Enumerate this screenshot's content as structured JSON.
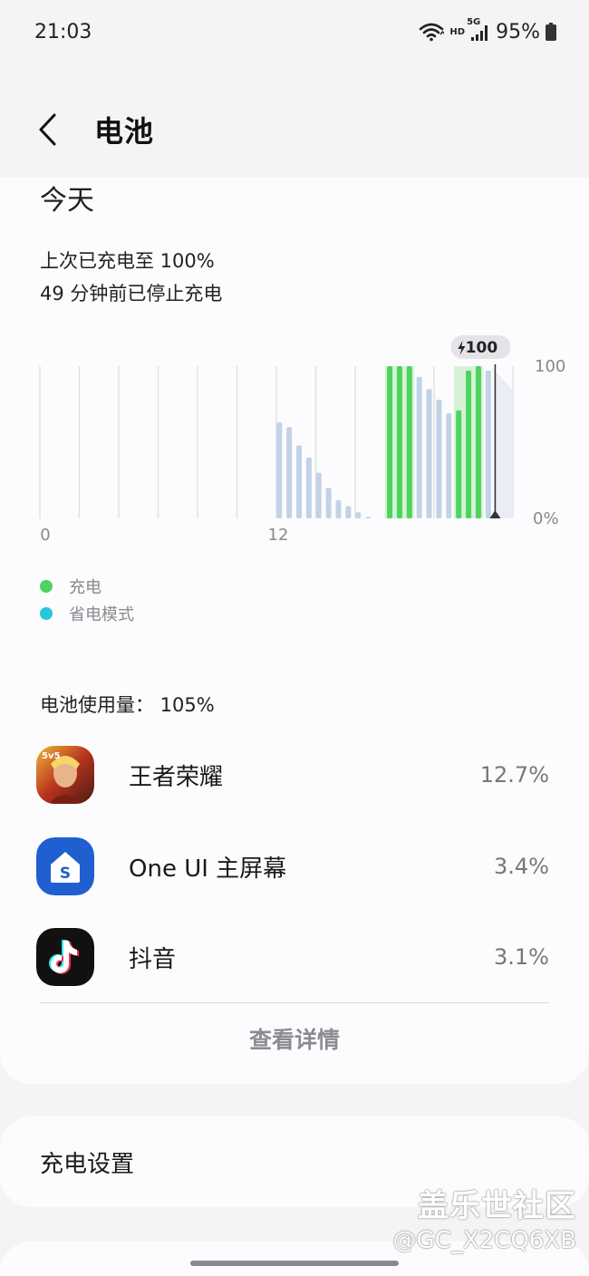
{
  "status_bar": {
    "time": "21:03",
    "hd": "HD",
    "network": "5G",
    "battery": "95%"
  },
  "header": {
    "title": "电池"
  },
  "summary": {
    "day_label": "今天",
    "last_charged": "上次已充电至 100%",
    "stopped": "49 分钟前已停止充电"
  },
  "chart_data": {
    "type": "bar",
    "x_tick_labels": [
      "0",
      "12"
    ],
    "y_tick_labels": [
      "100",
      "0%"
    ],
    "ylim": [
      0,
      100
    ],
    "charge_marker": "100",
    "series": [
      {
        "name": "充电",
        "color": "#4cd45e"
      },
      {
        "name": "省电模式",
        "color": "#26c7dc"
      }
    ],
    "bars": [
      {
        "slot": 12.15,
        "value": 63,
        "charging": false
      },
      {
        "slot": 12.65,
        "value": 60,
        "charging": false
      },
      {
        "slot": 13.15,
        "value": 48,
        "charging": false
      },
      {
        "slot": 13.65,
        "value": 40,
        "charging": false
      },
      {
        "slot": 14.15,
        "value": 30,
        "charging": false
      },
      {
        "slot": 14.65,
        "value": 20,
        "charging": false
      },
      {
        "slot": 15.15,
        "value": 12,
        "charging": false
      },
      {
        "slot": 15.65,
        "value": 8,
        "charging": false
      },
      {
        "slot": 16.15,
        "value": 4,
        "charging": false
      },
      {
        "slot": 16.65,
        "value": 1,
        "charging": false
      },
      {
        "slot": 17.75,
        "value": 100,
        "charging": true
      },
      {
        "slot": 18.25,
        "value": 100,
        "charging": true
      },
      {
        "slot": 18.75,
        "value": 100,
        "charging": true
      },
      {
        "slot": 19.25,
        "value": 93,
        "charging": false
      },
      {
        "slot": 19.75,
        "value": 85,
        "charging": false
      },
      {
        "slot": 20.25,
        "value": 78,
        "charging": false
      },
      {
        "slot": 20.75,
        "value": 69,
        "charging": false
      },
      {
        "slot": 21.25,
        "value": 71,
        "charging": true
      },
      {
        "slot": 21.75,
        "value": 97,
        "charging": true
      },
      {
        "slot": 22.25,
        "value": 100,
        "charging": true
      },
      {
        "slot": 22.75,
        "value": 97,
        "charging": false
      }
    ],
    "charging_bands": [
      [
        17.5,
        19.0
      ],
      [
        21.0,
        22.5
      ]
    ],
    "now_hour": 23.1,
    "forecast": [
      [
        23.1,
        97
      ],
      [
        24,
        84
      ]
    ]
  },
  "legend": [
    {
      "label": "充电",
      "color": "#4cd45e"
    },
    {
      "label": "省电模式",
      "color": "#26c7dc"
    }
  ],
  "usage": {
    "title": "电池使用量： 105%",
    "apps": [
      {
        "name": "王者荣耀",
        "percent": "12.7%",
        "icon": "honor-of-kings-icon"
      },
      {
        "name": "One UI 主屏幕",
        "percent": "3.4%",
        "icon": "one-ui-home-icon"
      },
      {
        "name": "抖音",
        "percent": "3.1%",
        "icon": "douyin-icon"
      }
    ],
    "details_label": "查看详情"
  },
  "charging_settings": {
    "label": "充电设置"
  },
  "watermark": {
    "line1": "盖乐世社区",
    "line2": "@GC_X2CQ6XB"
  }
}
